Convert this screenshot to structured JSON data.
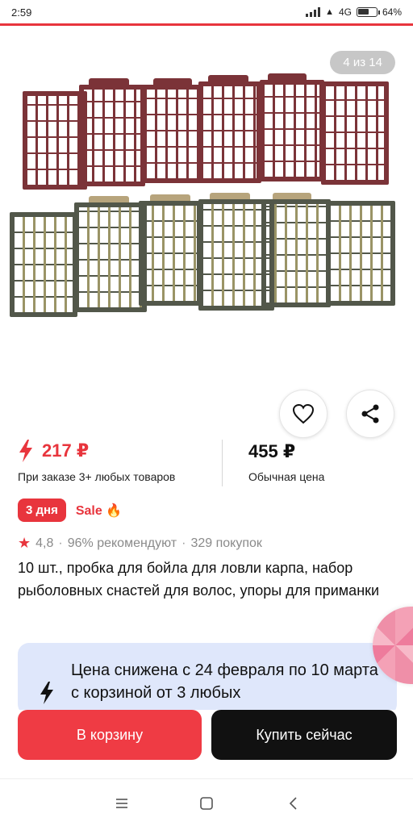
{
  "status_bar": {
    "time": "2:59",
    "network": "4G",
    "battery": "64%",
    "battery_level": 0.64
  },
  "gallery": {
    "counter": "4 из 14"
  },
  "price": {
    "sale_value": "217 ₽",
    "sale_note": "При заказе 3+ любых товаров",
    "regular_value": "455 ₽",
    "regular_note": "Обычная цена"
  },
  "badges": {
    "days": "3 дня",
    "sale": "Sale 🔥"
  },
  "rating": {
    "value": "4,8",
    "recommend": "96% рекомендуют",
    "purchases": "329 покупок",
    "separator": "·"
  },
  "product": {
    "title": "10 шт., пробка для бойла для ловли карпа, набор рыболовных снастей для волос, упоры для приманки"
  },
  "promo": {
    "text": "Цена снижена с 24 февраля по 10 марта с корзиной от 3 любых"
  },
  "actions": {
    "cart_label": "В корзину",
    "buy_label": "Купить сейчас"
  },
  "colors": {
    "accent": "#e8353d",
    "dark": "#111111",
    "promo_bg": "#dfe7fb"
  },
  "icons": {
    "favorite": "heart-icon",
    "share": "share-icon",
    "lightning": "lightning-icon",
    "star": "star-icon",
    "nav_menu": "menu-icon",
    "nav_home": "home-square-icon",
    "nav_back": "back-chevron-icon"
  }
}
